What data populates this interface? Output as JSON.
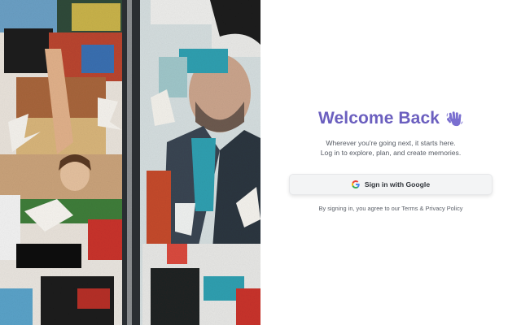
{
  "hero": {
    "icon": "collage-photo",
    "colors": {
      "teal": "#2f9fb0",
      "red": "#c8322c",
      "jacket": "#3a4552"
    }
  },
  "login": {
    "title": "Welcome Back",
    "title_icon": "waving-hand-icon",
    "subtitle_line1": "Wherever you're going next, it starts here.",
    "subtitle_line2": "Log in to explore, plan, and create memories.",
    "google_button": {
      "label": "Sign in with Google",
      "icon": "google-icon"
    },
    "legal": {
      "prefix": "By signing in, you agree to our ",
      "terms": "Terms",
      "separator": " & ",
      "privacy": "Privacy Policy"
    }
  },
  "theme": {
    "accent": "#6b5fbf",
    "text_muted": "#555a63",
    "button_bg": "#f3f4f5"
  }
}
